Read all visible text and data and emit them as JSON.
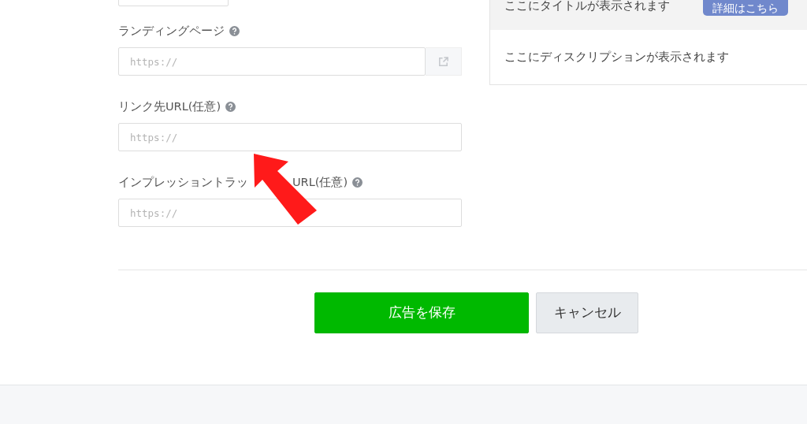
{
  "form": {
    "fields": [
      {
        "kind": "link",
        "label": "ランディングページ",
        "help": true,
        "placeholder": "https://"
      },
      {
        "kind": "plain",
        "label": "リンク先URL(任意)",
        "help": true,
        "placeholder": "https://"
      },
      {
        "kind": "plain",
        "label": "インプレッショントラッ",
        "label_tail": "URL(任意)",
        "help": true,
        "placeholder": "https://"
      }
    ]
  },
  "preview": {
    "title": "ここにタイトルが表示されます",
    "button": "詳細はこちら",
    "description": "ここにディスクリプションが表示されます"
  },
  "buttons": [
    {
      "kind": "primary",
      "label": "広告を保存"
    },
    {
      "kind": "secondary",
      "label": "キャンセル"
    }
  ],
  "annotation": {
    "kind": "arrow"
  }
}
